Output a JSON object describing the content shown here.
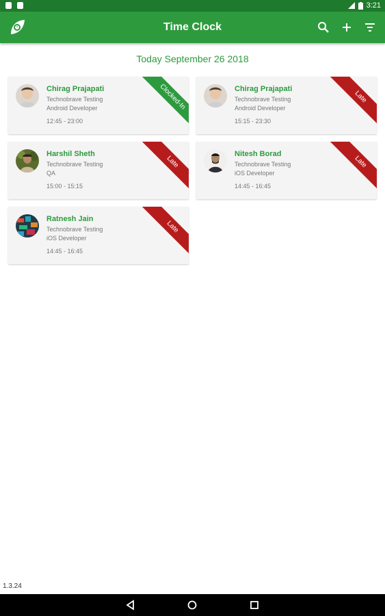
{
  "status_bar": {
    "time": "3:21"
  },
  "app_bar": {
    "title": "Time Clock",
    "icons": [
      "logo-icon",
      "search-icon",
      "add-icon",
      "filter-icon"
    ]
  },
  "date_header": "Today September 26 2018",
  "colors": {
    "primary": "#2e9a3e",
    "status_bar": "#1e7a2c",
    "clocked_in": "#2e9a3e",
    "late": "#b71c1c"
  },
  "cards": [
    {
      "name": "Chirag Prajapati",
      "company": "Technobrave Testing",
      "role": "Android Developer",
      "time": "12:45 - 23:00",
      "status": "Clocked-In"
    },
    {
      "name": "Chirag Prajapati",
      "company": "Technobrave Testing",
      "role": "Android Developer",
      "time": "15:15 - 23:30",
      "status": "Late"
    },
    {
      "name": "Harshil Sheth",
      "company": "Technobrave Testing",
      "role": "QA",
      "time": "15:00 - 15:15",
      "status": "Late"
    },
    {
      "name": "Nitesh Borad",
      "company": "Technobrave Testing",
      "role": "iOS Developer",
      "time": "14:45 - 16:45",
      "status": "Late"
    },
    {
      "name": "Ratnesh Jain",
      "company": "Technobrave Testing",
      "role": "iOS Developer",
      "time": "14:45 - 16:45",
      "status": "Late"
    }
  ],
  "version": "1.3.24",
  "nav_bar": {
    "icons": [
      "back-icon",
      "home-icon",
      "recents-icon"
    ]
  }
}
